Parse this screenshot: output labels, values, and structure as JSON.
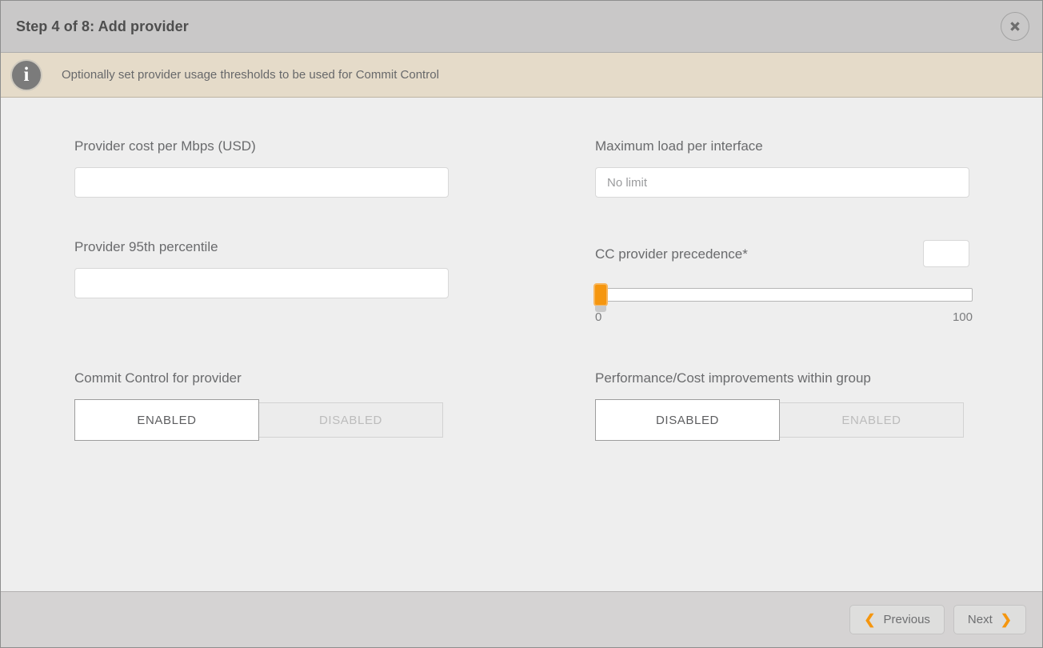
{
  "dialog": {
    "title": "Step 4 of 8: Add provider",
    "close_icon": "close-icon"
  },
  "info": {
    "icon": "info-icon",
    "message": "Optionally set provider usage thresholds to be used for Commit Control"
  },
  "form": {
    "left": {
      "provider_cost": {
        "label": "Provider cost per Mbps (USD)",
        "value": "",
        "placeholder": ""
      },
      "provider_percentile": {
        "label": "Provider 95th percentile",
        "value": "",
        "placeholder": ""
      },
      "commit_control": {
        "label": "Commit Control for provider",
        "options": [
          "ENABLED",
          "DISABLED"
        ],
        "selected": "ENABLED"
      }
    },
    "right": {
      "max_load": {
        "label": "Maximum load per interface",
        "value": "",
        "placeholder": "No limit"
      },
      "cc_precedence": {
        "label": "CC provider precedence*",
        "value": "",
        "placeholder": "",
        "slider": {
          "min_label": "0",
          "max_label": "100",
          "min": 0,
          "max": 100,
          "value": 0,
          "handle_color": "#f5960f"
        }
      },
      "perf_cost": {
        "label": "Performance/Cost improvements within group",
        "options": [
          "DISABLED",
          "ENABLED"
        ],
        "selected": "DISABLED"
      }
    }
  },
  "footer": {
    "previous_label": "Previous",
    "next_label": "Next",
    "previous_chevron": "❮",
    "next_chevron": "❯"
  }
}
